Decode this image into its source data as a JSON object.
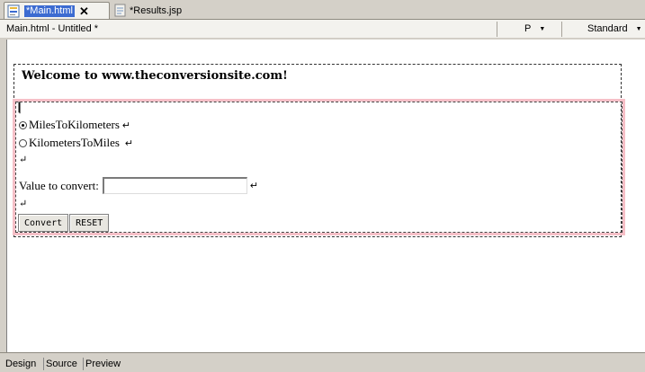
{
  "tabs": [
    {
      "label": "*Main.html",
      "icon": "html-file-icon",
      "active": true
    },
    {
      "label": "*Results.jsp",
      "icon": "jsp-file-icon",
      "active": false
    }
  ],
  "infobar": {
    "doc_title": "Main.html - Untitled *",
    "paragraph_style": "P",
    "mode": "Standard"
  },
  "page": {
    "welcome": "Welcome to www.theconversionsite.com!",
    "radio_options": [
      {
        "label": "MilesToKilometers",
        "checked": true
      },
      {
        "label": "KilometersToMiles",
        "checked": false
      }
    ],
    "value_label": "Value to convert:",
    "value_input": "",
    "convert_label": "Convert",
    "reset_label": "RESET",
    "return_mark": "↵"
  },
  "view_tabs": [
    "Design",
    "Source",
    "Preview"
  ],
  "colors": {
    "tab_highlight": "#3c6bd1",
    "form_border": "#f6bfc7",
    "chrome": "#d4d0c8"
  }
}
